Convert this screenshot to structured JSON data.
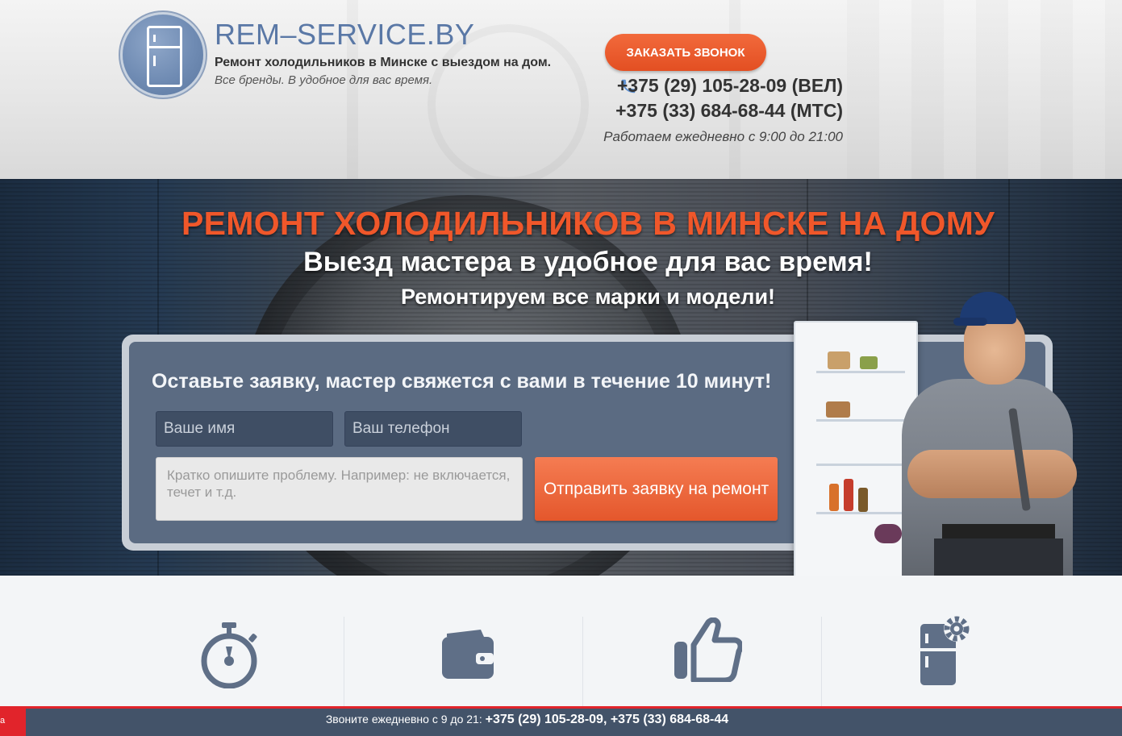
{
  "header": {
    "brand": "REM–SERVICE.BY",
    "tagline": "Ремонт холодильников в Минске с выездом на дом.",
    "tagline2": "Все бренды. В удобное для вас время.",
    "call_button": "ЗАКАЗАТЬ ЗВОНОК",
    "phone1": "+375 (29) 105-28-09 (ВЕЛ)",
    "phone2": "+375 (33) 684-68-44 (МТС)",
    "hours": "Работаем ежедневно с 9:00 до 21:00"
  },
  "hero": {
    "title": "РЕМОНТ ХОЛОДИЛЬНИКОВ В МИНСКЕ НА ДОМУ",
    "subtitle1": "Выезд мастера в удобное для вас время!",
    "subtitle2": "Ремонтируем все марки и модели!"
  },
  "form": {
    "title": "Оставьте заявку, мастер свяжется с вами в течение 10 минут!",
    "name_placeholder": "Ваше имя",
    "phone_placeholder": "Ваш телефон",
    "message_placeholder": "Кратко опишите проблему. Например: не включается, течет и т.д.",
    "submit_label": "Отправить заявку на ремонт"
  },
  "features": {
    "icons": [
      "stopwatch-icon",
      "wallet-icon",
      "thumbs-up-icon",
      "fridge-gear-icon"
    ]
  },
  "bottom_bar": {
    "left_label": "а",
    "prefix": "Звоните ежедневно с 9 до 21: ",
    "phones": "+375 (29) 105-28-09, +375 (33) 684-68-44"
  },
  "colors": {
    "accent_orange": "#f0572a",
    "brand_blue": "#5a78a6",
    "form_panel": "#5b6b82",
    "bottom_bar": "#435369",
    "bottom_border_red": "#e1242b"
  }
}
